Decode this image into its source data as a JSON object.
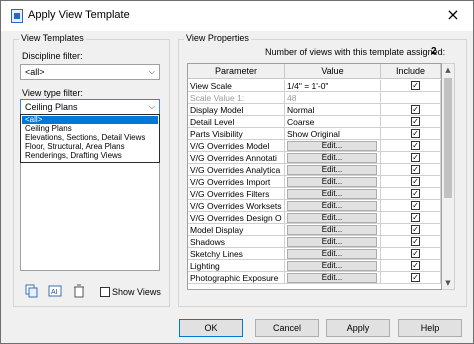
{
  "window": {
    "title": "Apply View Template"
  },
  "view_templates": {
    "group_label": "View Templates",
    "discipline_label": "Discipline filter:",
    "discipline_value": "<all>",
    "view_type_label": "View type filter:",
    "view_type_value": "Ceiling Plans",
    "dropdown_options": [
      "<all>",
      "Ceiling Plans",
      "Elevations, Sections, Detail Views",
      "Floor, Structural, Area Plans",
      "Renderings, Drafting Views"
    ],
    "dropdown_selected_index": 0,
    "show_views_label": "Show Views"
  },
  "view_properties": {
    "group_label": "View Properties",
    "assigned_label": "Number of views with this template assigned:",
    "assigned_count": "2",
    "columns": [
      "Parameter",
      "Value",
      "Include"
    ],
    "rows": [
      {
        "param": "View Scale",
        "value": "1/4\" = 1'-0\"",
        "type": "text",
        "include": true,
        "grey": false
      },
      {
        "param": "Scale Value    1:",
        "value": "48",
        "type": "text",
        "include": null,
        "grey": true
      },
      {
        "param": "Display Model",
        "value": "Normal",
        "type": "text",
        "include": true,
        "grey": false
      },
      {
        "param": "Detail Level",
        "value": "Coarse",
        "type": "text",
        "include": true,
        "grey": false
      },
      {
        "param": "Parts Visibility",
        "value": "Show Original",
        "type": "text",
        "include": true,
        "grey": false
      },
      {
        "param": "V/G Overrides Model",
        "value": "Edit...",
        "type": "button",
        "include": true,
        "grey": false
      },
      {
        "param": "V/G Overrides Annotati",
        "value": "Edit...",
        "type": "button",
        "include": true,
        "grey": false
      },
      {
        "param": "V/G Overrides Analytica",
        "value": "Edit...",
        "type": "button",
        "include": true,
        "grey": false
      },
      {
        "param": "V/G Overrides Import",
        "value": "Edit...",
        "type": "button",
        "include": true,
        "grey": false
      },
      {
        "param": "V/G Overrides Filters",
        "value": "Edit...",
        "type": "button",
        "include": true,
        "grey": false
      },
      {
        "param": "V/G Overrides Worksets",
        "value": "Edit...",
        "type": "button",
        "include": true,
        "grey": false
      },
      {
        "param": "V/G Overrides Design O",
        "value": "Edit...",
        "type": "button",
        "include": true,
        "grey": false
      },
      {
        "param": "Model Display",
        "value": "Edit...",
        "type": "button",
        "include": true,
        "grey": false
      },
      {
        "param": "Shadows",
        "value": "Edit...",
        "type": "button",
        "include": true,
        "grey": false
      },
      {
        "param": "Sketchy Lines",
        "value": "Edit...",
        "type": "button",
        "include": true,
        "grey": false
      },
      {
        "param": "Lighting",
        "value": "Edit...",
        "type": "button",
        "include": true,
        "grey": false
      },
      {
        "param": "Photographic Exposure",
        "value": "Edit...",
        "type": "button",
        "include": true,
        "grey": false
      }
    ]
  },
  "buttons": {
    "ok": "OK",
    "cancel": "Cancel",
    "apply": "Apply",
    "help": "Help"
  },
  "icons": {
    "title": "view-template-icon",
    "close": "×",
    "dropdown_arrow": "⌵",
    "check": "✓",
    "scroll_up": "▲",
    "scroll_down": "▼"
  },
  "colors": {
    "selection": "#0078d7",
    "focus_border": "#3c83d6"
  }
}
